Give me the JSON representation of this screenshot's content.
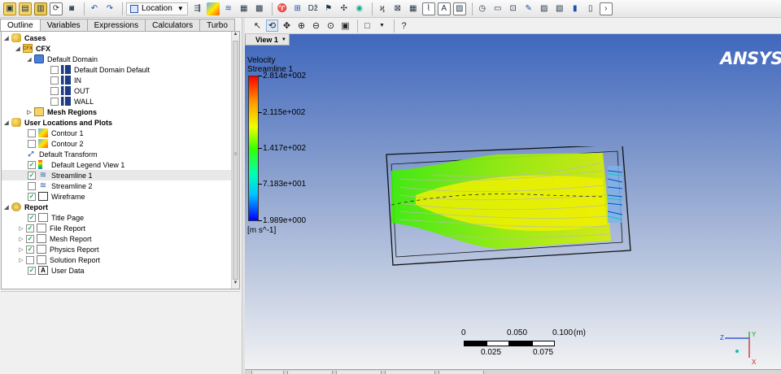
{
  "toolbar": {
    "location_label": "Location"
  },
  "tabs": [
    "Outline",
    "Variables",
    "Expressions",
    "Calculators",
    "Turbo"
  ],
  "tree": {
    "cases": "Cases",
    "cfx": "CFX",
    "default_domain": "Default Domain",
    "boundaries": [
      "Default Domain Default",
      "IN",
      "OUT",
      "WALL"
    ],
    "mesh_regions": "Mesh Regions",
    "user_locations": "User Locations and Plots",
    "plots": [
      {
        "label": "Contour 1",
        "checked": false
      },
      {
        "label": "Contour 2",
        "checked": false
      },
      {
        "label": "Default Transform",
        "checked": null
      },
      {
        "label": "Default Legend View 1",
        "checked": true
      },
      {
        "label": "Streamline 1",
        "checked": true
      },
      {
        "label": "Streamline 2",
        "checked": false
      },
      {
        "label": "Wireframe",
        "checked": true
      }
    ],
    "report": "Report",
    "report_items": [
      {
        "label": "Title Page",
        "checked": true
      },
      {
        "label": "File Report",
        "checked": true
      },
      {
        "label": "Mesh Report",
        "checked": true
      },
      {
        "label": "Physics Report",
        "checked": true
      },
      {
        "label": "Solution Report",
        "checked": false
      },
      {
        "label": "User Data",
        "checked": true
      }
    ]
  },
  "viewer": {
    "view_label": "View 1",
    "logo": "ANSYS",
    "legend": {
      "variable": "Velocity",
      "plot": "Streamline 1",
      "values": [
        "2.814e+002",
        "2.115e+002",
        "1.417e+002",
        "7.183e+001",
        "1.989e+000"
      ],
      "unit": "[m s^-1]"
    },
    "scale": {
      "top_labels": [
        "0",
        "0.050",
        "0.100"
      ],
      "unit": "(m)",
      "bottom_labels": [
        "0.025",
        "0.075"
      ]
    },
    "axes": {
      "z": "Z",
      "y": "Y",
      "x": "X"
    }
  },
  "colors": {
    "viewport_top": "#3f67bd",
    "viewport_bottom": "#f4f4f4",
    "streamline_green": "#39f000",
    "streamline_yellow": "#f0f000"
  }
}
